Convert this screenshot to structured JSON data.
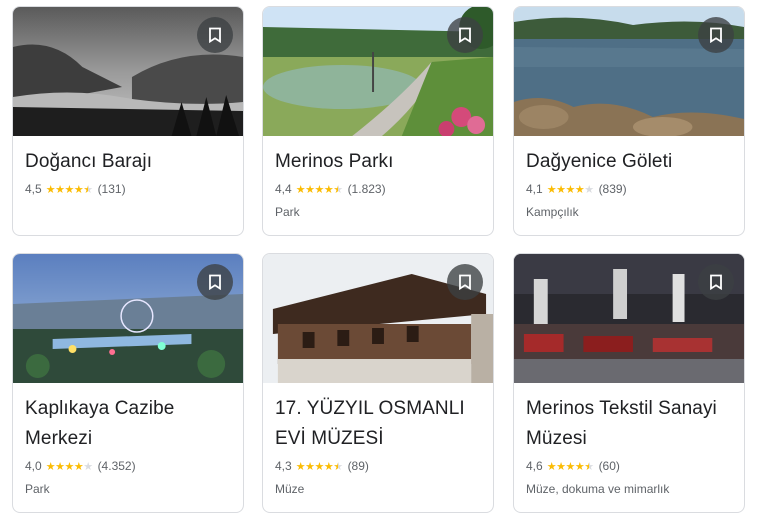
{
  "cards": [
    {
      "title": "Doğancı Barajı",
      "rating": "4,5",
      "stars": 4.5,
      "reviews": "(131)",
      "category": ""
    },
    {
      "title": "Merinos Parkı",
      "rating": "4,4",
      "stars": 4.4,
      "reviews": "(1.823)",
      "category": "Park"
    },
    {
      "title": "Dağyenice Göleti",
      "rating": "4,1",
      "stars": 4.1,
      "reviews": "(839)",
      "category": "Kampçılık"
    },
    {
      "title": "Kaplıkaya Cazibe Merkezi",
      "rating": "4,0",
      "stars": 4.0,
      "reviews": "(4.352)",
      "category": "Park"
    },
    {
      "title": "17. YÜZYIL OSMANLI EVİ MÜZESİ",
      "rating": "4,3",
      "stars": 4.3,
      "reviews": "(89)",
      "category": "Müze"
    },
    {
      "title": "Merinos Tekstil Sanayi Müzesi",
      "rating": "4,6",
      "stars": 4.6,
      "reviews": "(60)",
      "category": "Müze, dokuma ve mimarlık"
    }
  ],
  "icons": {
    "save": "bookmark-icon",
    "star": "star-icon"
  },
  "colors": {
    "star": "#fbbc04",
    "star_off": "#dadce0",
    "save_button_bg": "#3c4043"
  }
}
